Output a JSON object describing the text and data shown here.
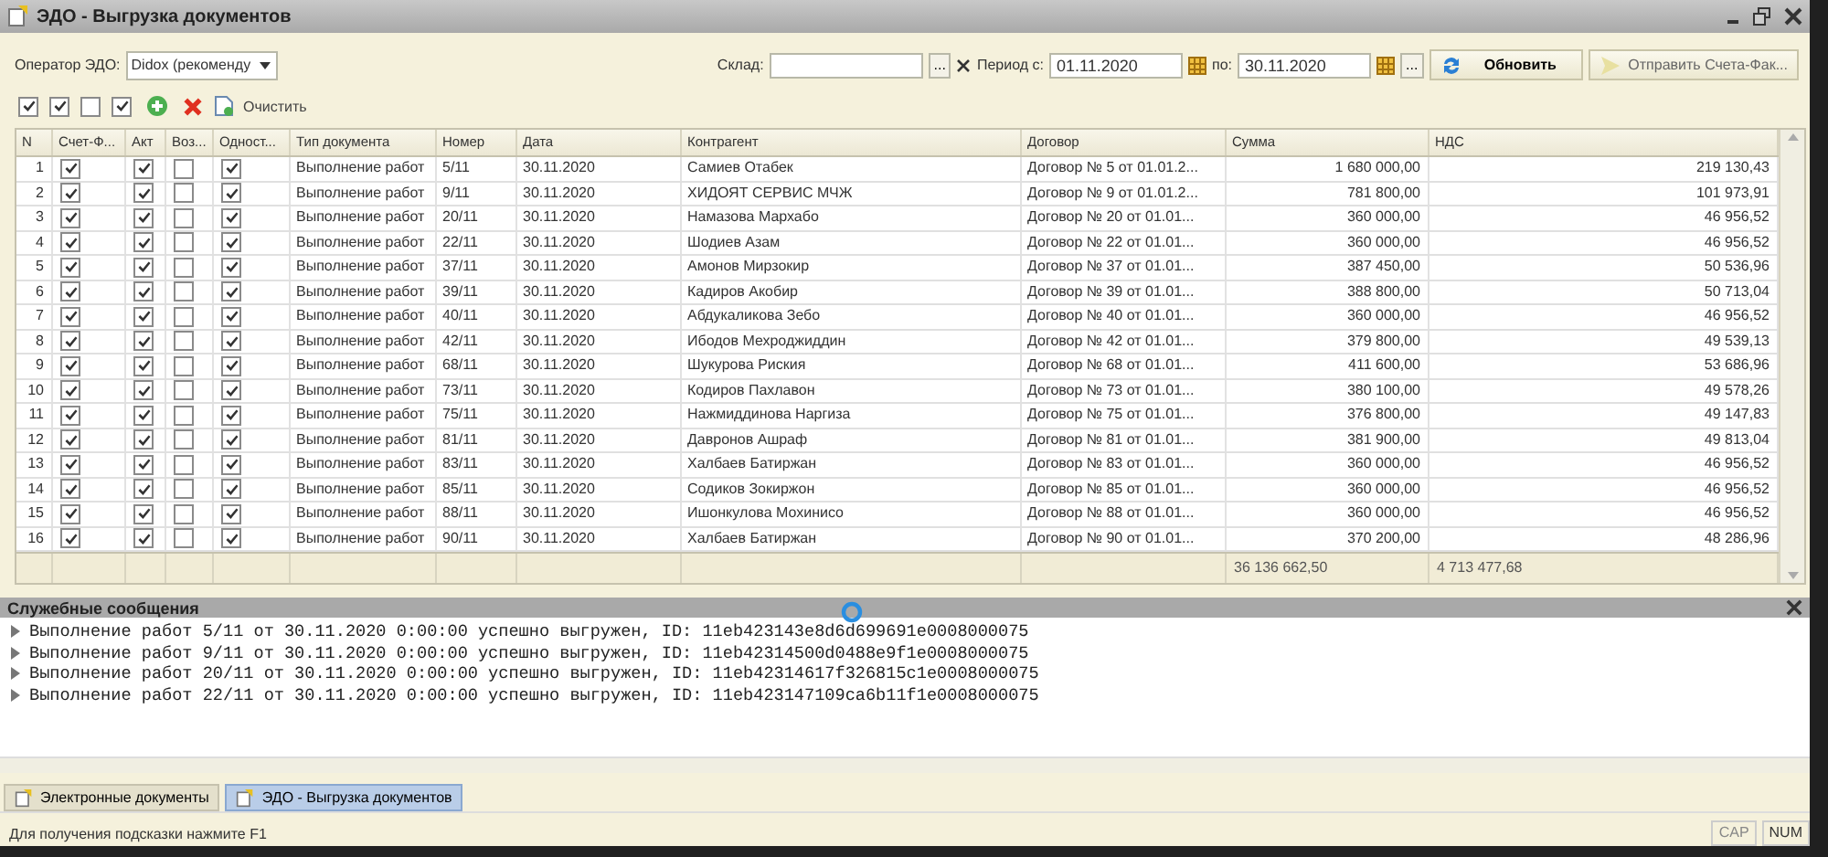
{
  "window": {
    "title": "ЭДО - Выгрузка документов"
  },
  "filters": {
    "operator_label": "Оператор ЭДО:",
    "operator_value": "Didox (рекоменду",
    "warehouse_label": "Склад:",
    "warehouse_button": "...",
    "period_from_label": "Период с:",
    "period_from": "01.11.2020",
    "period_to_label": "по:",
    "period_to": "30.11.2020",
    "period_button": "...",
    "refresh_button": "Обновить",
    "send_button": "Отправить Счета-Фак..."
  },
  "toolbar": {
    "checkboxes": [
      {
        "checked": true
      },
      {
        "checked": true
      },
      {
        "checked": false
      },
      {
        "checked": true
      }
    ],
    "clear_button": "Очистить"
  },
  "table": {
    "columns": [
      "N",
      "Счет-Ф...",
      "Акт",
      "Воз...",
      "Одност...",
      "Тип документа",
      "Номер",
      "Дата",
      "Контрагент",
      "Договор",
      "Сумма",
      "НДС"
    ],
    "rows": [
      {
        "n": "1",
        "invoice": true,
        "act": true,
        "ret": false,
        "unilateral": true,
        "type": "Выполнение работ",
        "number": "5/11",
        "date": "30.11.2020",
        "counterparty": "Самиев Отабек",
        "contract": "Договор № 5 от 01.01.2...",
        "sum": "1 680 000,00",
        "vat": "219 130,43"
      },
      {
        "n": "2",
        "invoice": true,
        "act": true,
        "ret": false,
        "unilateral": true,
        "type": "Выполнение работ",
        "number": "9/11",
        "date": "30.11.2020",
        "counterparty": "ХИДОЯТ СЕРВИС  МЧЖ",
        "contract": "Договор № 9 от 01.01.2...",
        "sum": "781 800,00",
        "vat": "101 973,91"
      },
      {
        "n": "3",
        "invoice": true,
        "act": true,
        "ret": false,
        "unilateral": true,
        "type": "Выполнение работ",
        "number": "20/11",
        "date": "30.11.2020",
        "counterparty": "Намазова Мархабо",
        "contract": "Договор № 20 от 01.01...",
        "sum": "360 000,00",
        "vat": "46 956,52"
      },
      {
        "n": "4",
        "invoice": true,
        "act": true,
        "ret": false,
        "unilateral": true,
        "type": "Выполнение работ",
        "number": "22/11",
        "date": "30.11.2020",
        "counterparty": "Шодиев Азам",
        "contract": "Договор № 22 от 01.01...",
        "sum": "360 000,00",
        "vat": "46 956,52"
      },
      {
        "n": "5",
        "invoice": true,
        "act": true,
        "ret": false,
        "unilateral": true,
        "type": "Выполнение работ",
        "number": "37/11",
        "date": "30.11.2020",
        "counterparty": "Амонов Мирзокир",
        "contract": "Договор № 37 от 01.01...",
        "sum": "387 450,00",
        "vat": "50 536,96"
      },
      {
        "n": "6",
        "invoice": true,
        "act": true,
        "ret": false,
        "unilateral": true,
        "type": "Выполнение работ",
        "number": "39/11",
        "date": "30.11.2020",
        "counterparty": "Кадиров Акобир",
        "contract": "Договор № 39 от 01.01...",
        "sum": "388 800,00",
        "vat": "50 713,04"
      },
      {
        "n": "7",
        "invoice": true,
        "act": true,
        "ret": false,
        "unilateral": true,
        "type": "Выполнение работ",
        "number": "40/11",
        "date": "30.11.2020",
        "counterparty": "Абдукаликова Зебо",
        "contract": "Договор № 40 от 01.01...",
        "sum": "360 000,00",
        "vat": "46 956,52"
      },
      {
        "n": "8",
        "invoice": true,
        "act": true,
        "ret": false,
        "unilateral": true,
        "type": "Выполнение работ",
        "number": "42/11",
        "date": "30.11.2020",
        "counterparty": "Ибодов Мехроджиддин",
        "contract": "Договор № 42 от 01.01...",
        "sum": "379 800,00",
        "vat": "49 539,13"
      },
      {
        "n": "9",
        "invoice": true,
        "act": true,
        "ret": false,
        "unilateral": true,
        "type": "Выполнение работ",
        "number": "68/11",
        "date": "30.11.2020",
        "counterparty": "Шукурова Риския",
        "contract": "Договор № 68 от 01.01...",
        "sum": "411 600,00",
        "vat": "53 686,96"
      },
      {
        "n": "10",
        "invoice": true,
        "act": true,
        "ret": false,
        "unilateral": true,
        "type": "Выполнение работ",
        "number": "73/11",
        "date": "30.11.2020",
        "counterparty": "Кодиров Пахлавон",
        "contract": "Договор № 73 от 01.01...",
        "sum": "380 100,00",
        "vat": "49 578,26"
      },
      {
        "n": "11",
        "invoice": true,
        "act": true,
        "ret": false,
        "unilateral": true,
        "type": "Выполнение работ",
        "number": "75/11",
        "date": "30.11.2020",
        "counterparty": "Нажмиддинова Наргиза",
        "contract": "Договор № 75 от 01.01...",
        "sum": "376 800,00",
        "vat": "49 147,83"
      },
      {
        "n": "12",
        "invoice": true,
        "act": true,
        "ret": false,
        "unilateral": true,
        "type": "Выполнение работ",
        "number": "81/11",
        "date": "30.11.2020",
        "counterparty": "Давронов Ашраф",
        "contract": "Договор № 81 от 01.01...",
        "sum": "381 900,00",
        "vat": "49 813,04"
      },
      {
        "n": "13",
        "invoice": true,
        "act": true,
        "ret": false,
        "unilateral": true,
        "type": "Выполнение работ",
        "number": "83/11",
        "date": "30.11.2020",
        "counterparty": "Халбаев Батиржан",
        "contract": "Договор № 83 от 01.01...",
        "sum": "360 000,00",
        "vat": "46 956,52"
      },
      {
        "n": "14",
        "invoice": true,
        "act": true,
        "ret": false,
        "unilateral": true,
        "type": "Выполнение работ",
        "number": "85/11",
        "date": "30.11.2020",
        "counterparty": "Содиков Зокиржон",
        "contract": "Договор № 85 от 01.01...",
        "sum": "360 000,00",
        "vat": "46 956,52"
      },
      {
        "n": "15",
        "invoice": true,
        "act": true,
        "ret": false,
        "unilateral": true,
        "type": "Выполнение работ",
        "number": "88/11",
        "date": "30.11.2020",
        "counterparty": "Ишонкулова Мохинисо",
        "contract": "Договор № 88 от 01.01...",
        "sum": "360 000,00",
        "vat": "46 956,52"
      },
      {
        "n": "16",
        "invoice": true,
        "act": true,
        "ret": false,
        "unilateral": true,
        "type": "Выполнение работ",
        "number": "90/11",
        "date": "30.11.2020",
        "counterparty": "Халбаев Батиржан",
        "contract": "Договор № 90 от 01.01...",
        "sum": "370 200,00",
        "vat": "48 286,96"
      }
    ],
    "totals": {
      "sum": "36 136 662,50",
      "vat": "4 713 477,68"
    }
  },
  "messages": {
    "title": "Служебные сообщения",
    "items": [
      "Выполнение работ 5/11 от 30.11.2020 0:00:00 успешно выгружен, ID: 11eb423143e8d6d699691e0008000075",
      "Выполнение работ 9/11 от 30.11.2020 0:00:00 успешно выгружен, ID: 11eb42314500d0488e9f1e0008000075",
      "Выполнение работ 20/11 от 30.11.2020 0:00:00 успешно выгружен, ID: 11eb42314617f326815c1e0008000075",
      "Выполнение работ 22/11 от 30.11.2020 0:00:00 успешно выгружен, ID: 11eb423147109ca6b11f1e0008000075"
    ]
  },
  "taskbar": [
    {
      "label": "Электронные документы",
      "selected": false
    },
    {
      "label": "ЭДО - Выгрузка документов",
      "selected": true
    }
  ],
  "status_bar": {
    "hint": "Для получения подсказки нажмите F1",
    "indicators": [
      "CAP",
      "NUM"
    ]
  }
}
